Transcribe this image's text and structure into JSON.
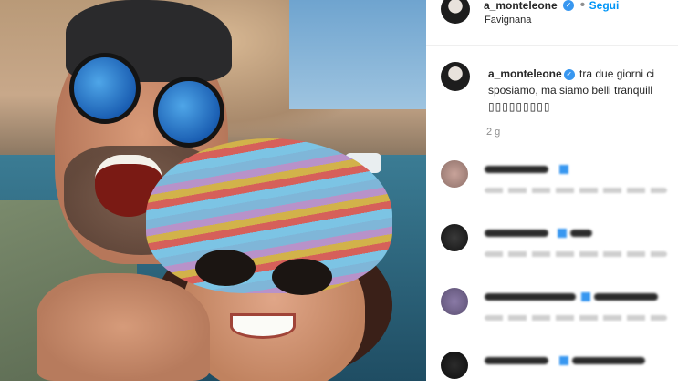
{
  "header": {
    "username": "a_monteleone",
    "separator": "•",
    "follow_label": "Segui",
    "location": "Favignana"
  },
  "caption": {
    "username": "a_monteleone",
    "text": "tra due giorni ci sposiamo, ma siamo belli tranquill",
    "emoji_line": "▯▯▯▯▯▯▯▯▯",
    "age": "2 g"
  },
  "colors": {
    "accent": "#0095f6",
    "verified": "#3897f0"
  },
  "icons": {
    "verified": "verified-badge-icon"
  }
}
